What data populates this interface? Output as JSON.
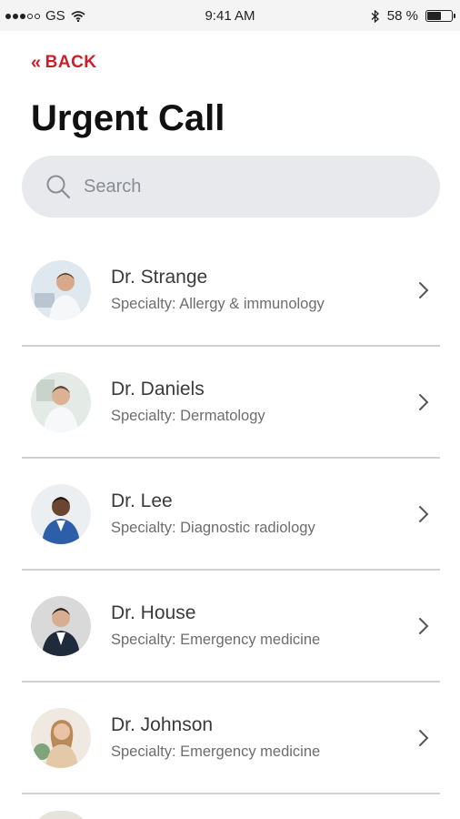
{
  "status_bar": {
    "carrier": "GS",
    "time": "9:41 AM",
    "battery_text": "58 %",
    "battery_level": 0.58
  },
  "nav": {
    "back_label": "BACK"
  },
  "page": {
    "title": "Urgent Call"
  },
  "search": {
    "placeholder": "Search"
  },
  "doctors": [
    {
      "name": "Dr. Strange",
      "specialty": "Specialty: Allergy & immunology"
    },
    {
      "name": "Dr. Daniels",
      "specialty": "Specialty: Dermatology"
    },
    {
      "name": "Dr. Lee",
      "specialty": "Specialty: Diagnostic radiology"
    },
    {
      "name": "Dr. House",
      "specialty": "Specialty: Emergency medicine"
    },
    {
      "name": "Dr. Johnson",
      "specialty": "Specialty: Emergency medicine"
    }
  ],
  "colors": {
    "accent": "#cc1f2b",
    "search_bg": "#e7e9ec",
    "divider": "#cfd1d4"
  }
}
